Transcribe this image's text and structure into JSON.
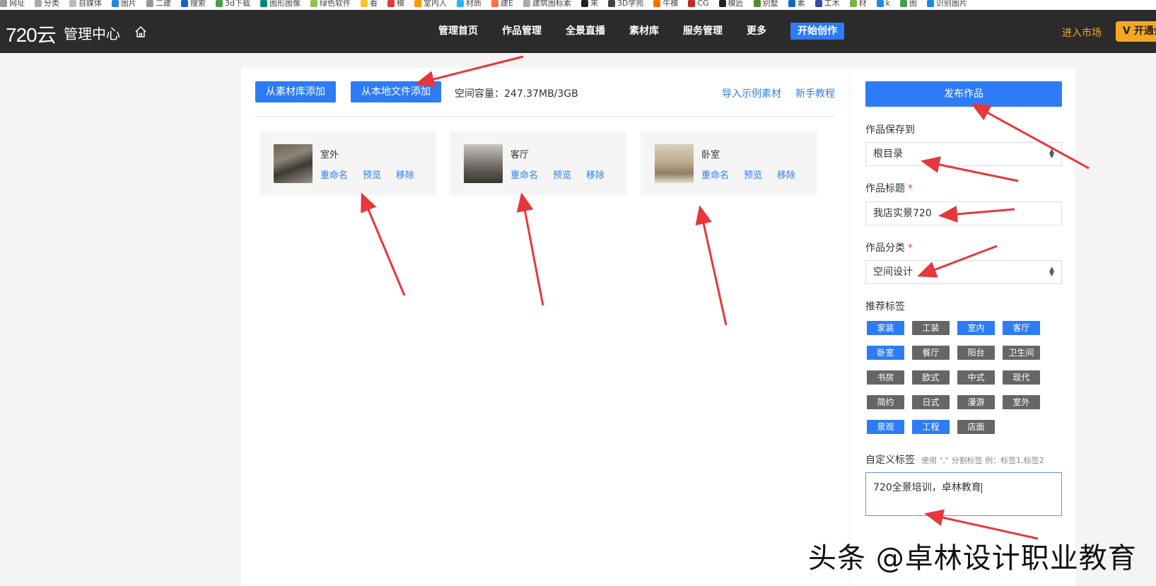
{
  "bookmarks": [
    "网址",
    "分类",
    "自媒体",
    "图片",
    "二建",
    "搜索",
    "3d下载",
    "图形图像",
    "绿色软件",
    "看",
    "模",
    "室内人",
    "材质",
    "建E",
    "建筑图标素",
    "来",
    "3D学苑",
    "牛模",
    "CG",
    "模匠",
    "别墅",
    "素",
    "工木",
    "材",
    "k",
    "图",
    "识别图片"
  ],
  "colors": {
    "accent": "#2d7cf6",
    "nav_bg": "#2b2b2b",
    "market": "#f5a623",
    "tag_off": "#666666",
    "arrow": "#e8373a"
  },
  "topnav": {
    "logo": "720云",
    "title": "管理中心",
    "home_icon": "home-icon",
    "items": [
      "管理首页",
      "作品管理",
      "全景直播",
      "素材库",
      "服务管理",
      "更多"
    ],
    "cta": "开始创作",
    "market": "进入市场",
    "vip": "V 开通会员"
  },
  "main": {
    "btn_library": "从素材库添加",
    "btn_local": "从本地文件添加",
    "capacity": "空间容量：247.37MB/3GB",
    "link_sample": "导入示例素材",
    "link_tutorial": "新手教程",
    "scenes": [
      {
        "name": "室外",
        "rename": "重命名",
        "preview": "预览",
        "remove": "移除"
      },
      {
        "name": "客厅",
        "rename": "重命名",
        "preview": "预览",
        "remove": "移除"
      },
      {
        "name": "卧室",
        "rename": "重命名",
        "preview": "预览",
        "remove": "移除"
      }
    ]
  },
  "side": {
    "publish": "发布作品",
    "save_to_label": "作品保存到",
    "save_to_value": "根目录",
    "title_label": "作品标题",
    "title_value": "我店实景720",
    "category_label": "作品分类",
    "category_value": "空间设计",
    "required_mark": "*",
    "tags_label": "推荐标签",
    "tags": [
      {
        "label": "家装",
        "on": true
      },
      {
        "label": "工装",
        "on": false
      },
      {
        "label": "室内",
        "on": true
      },
      {
        "label": "客厅",
        "on": true
      },
      {
        "label": "卧室",
        "on": true
      },
      {
        "label": "餐厅",
        "on": false
      },
      {
        "label": "阳台",
        "on": false
      },
      {
        "label": "卫生间",
        "on": false
      },
      {
        "label": "书房",
        "on": false
      },
      {
        "label": "欧式",
        "on": false
      },
      {
        "label": "中式",
        "on": false
      },
      {
        "label": "现代",
        "on": false
      },
      {
        "label": "简约",
        "on": false
      },
      {
        "label": "日式",
        "on": false
      },
      {
        "label": "漫游",
        "on": false
      },
      {
        "label": "室外",
        "on": false
      },
      {
        "label": "景观",
        "on": true
      },
      {
        "label": "工程",
        "on": true
      },
      {
        "label": "店面",
        "on": false
      }
    ],
    "custom_label": "自定义标签",
    "custom_hint": "使用 \",\" 分割标签 例：标签1,标签2",
    "custom_value": "720全景培训，卓林教育"
  },
  "watermark": "头条 @卓林设计职业教育"
}
